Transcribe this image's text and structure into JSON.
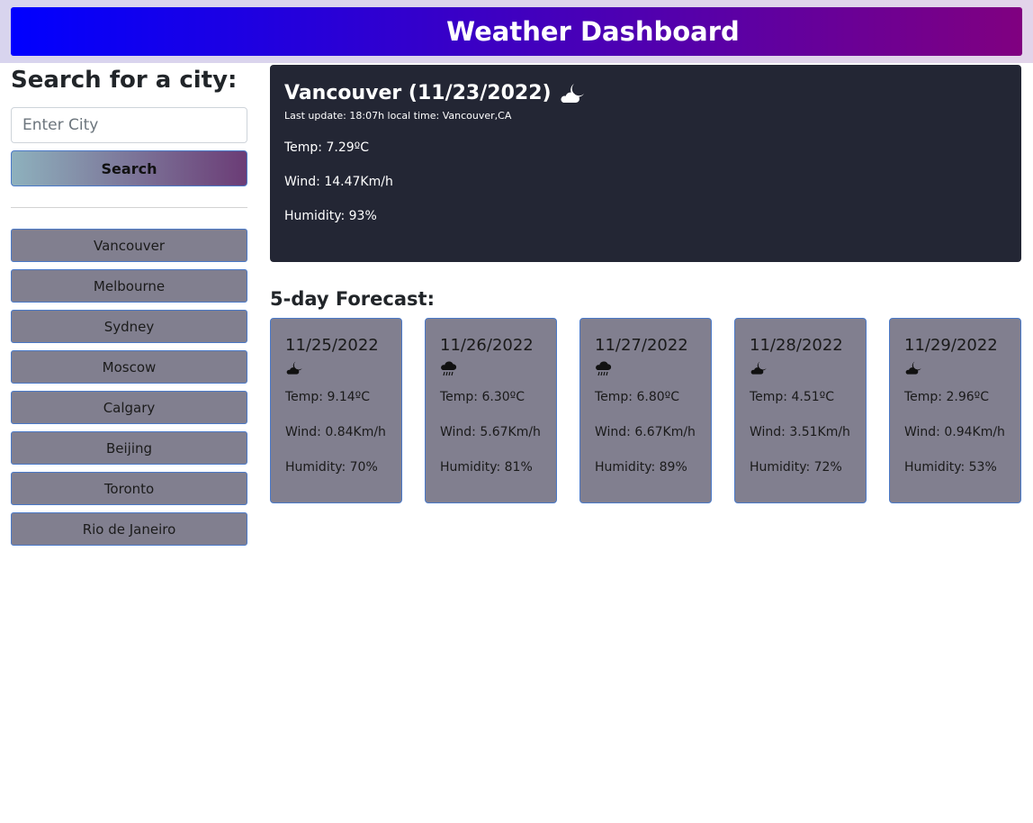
{
  "header": {
    "title": "Weather Dashboard"
  },
  "sidebar": {
    "search_title": "Search for a city:",
    "input_placeholder": "Enter City",
    "input_value": "",
    "search_label": "Search",
    "history": [
      "Vancouver",
      "Melbourne",
      "Sydney",
      "Moscow",
      "Calgary",
      "Beijing",
      "Toronto",
      "Rio de Janeiro"
    ]
  },
  "current": {
    "title": "Vancouver (11/23/2022)",
    "icon": "moon-cloud-icon",
    "updated": "Last update: 18:07h local time: Vancouver,CA",
    "temp": "Temp: 7.29ºC",
    "wind": "Wind: 14.47Km/h",
    "humidity": "Humidity: 93%"
  },
  "forecast": {
    "title": "5-day Forecast:",
    "days": [
      {
        "date": "11/25/2022",
        "icon": "moon-cloud-icon",
        "temp": "Temp: 9.14ºC",
        "wind": "Wind: 0.84Km/h",
        "humidity": "Humidity: 70%"
      },
      {
        "date": "11/26/2022",
        "icon": "rain-cloud-icon",
        "temp": "Temp: 6.30ºC",
        "wind": "Wind: 5.67Km/h",
        "humidity": "Humidity: 81%"
      },
      {
        "date": "11/27/2022",
        "icon": "rain-cloud-icon",
        "temp": "Temp: 6.80ºC",
        "wind": "Wind: 6.67Km/h",
        "humidity": "Humidity: 89%"
      },
      {
        "date": "11/28/2022",
        "icon": "moon-cloud-icon",
        "temp": "Temp: 4.51ºC",
        "wind": "Wind: 3.51Km/h",
        "humidity": "Humidity: 72%"
      },
      {
        "date": "11/29/2022",
        "icon": "moon-cloud-icon",
        "temp": "Temp: 2.96ºC",
        "wind": "Wind: 0.94Km/h",
        "humidity": "Humidity: 53%"
      }
    ]
  },
  "colors": {
    "header_gradient_start": "#0000ff",
    "header_gradient_end": "#800080",
    "current_card_bg": "#232634",
    "history_button_bg": "#817f8f",
    "button_border": "#4a79c8"
  }
}
